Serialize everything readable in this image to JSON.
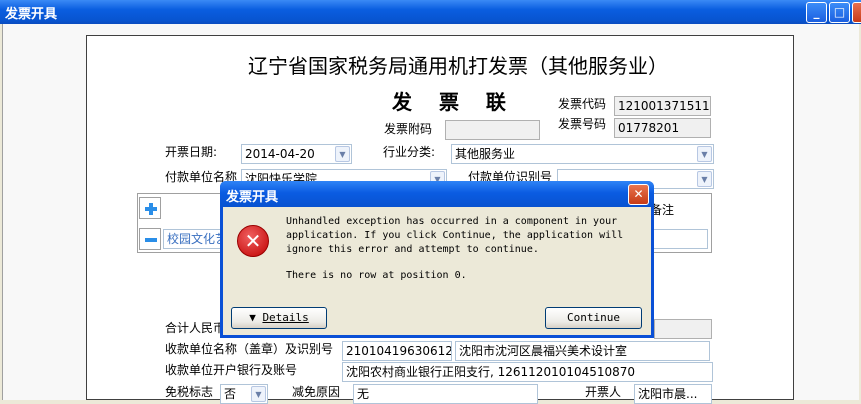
{
  "window": {
    "title": "发票开具"
  },
  "invoice": {
    "title": "辽宁省国家税务局通用机打发票（其他服务业）",
    "subtitle": "发 票 联",
    "code_label": "发票代码",
    "code_value": "121001371511",
    "number_label": "发票号码",
    "number_value": "01778201",
    "attach_label": "发票附码",
    "date_label": "开票日期:",
    "date_value": "2014-04-20",
    "industry_label": "行业分类:",
    "industry_value": "其他服务业",
    "payer_label": "付款单位名称",
    "payer_value": "沈阳快乐学院",
    "payer_id_label": "付款单位识别号",
    "note_label": "备注",
    "item_value": "校园文化艺",
    "total_label": "合计人民币",
    "payee_label": "收款单位名称（盖章）及识别号",
    "payee_id_value": "21010419630612...",
    "payee_name_value": "沈阳市沈河区晨福兴美术设计室",
    "bank_label": "收款单位开户银行及账号",
    "bank_value": "沈阳农村商业银行正阳支行, 126112010104510870",
    "tax_free_label": "免税标志",
    "tax_free_value": "否",
    "reduce_label": "减免原因",
    "reduce_value": "无",
    "issuer_label": "开票人",
    "issuer_value": "沈阳市晨..."
  },
  "dialog": {
    "title": "发票开具",
    "message": "Unhandled exception has occurred in a component in your\napplication. If you click Continue, the application will\nignore this error and attempt to continue.",
    "detail": "There is no row at position 0.",
    "details_button": "Details",
    "continue_button": "Continue"
  },
  "icons": {
    "add": "plus-icon",
    "remove": "minus-icon",
    "error": "error-icon",
    "dropdown": "chevron-down-icon"
  },
  "colors": {
    "titlebar": "#0a5ee0",
    "error_red": "#c00000",
    "field_border": "#b0c4d8"
  }
}
